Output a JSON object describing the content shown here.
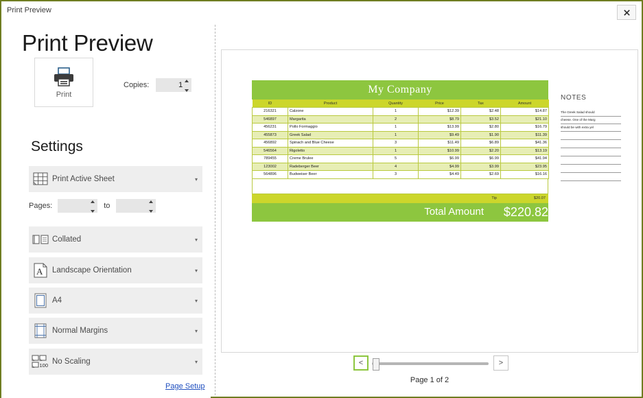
{
  "window": {
    "titlebar_text": "Print Preview",
    "close_icon": "close-icon",
    "border_color": "#6f7d21"
  },
  "left_panel": {
    "page_title": "Print Preview",
    "print_button": {
      "label": "Print",
      "icon": "printer-icon"
    },
    "copies": {
      "label": "Copies:",
      "value": "1"
    },
    "settings_heading": "Settings",
    "options": [
      {
        "label": "Print Active Sheet",
        "icon": "worksheet-grid-icon",
        "caret": "▾"
      },
      {
        "label": "Collated",
        "icon": "collate-pages-icon",
        "caret": "▾"
      },
      {
        "label": "Landscape Orientation",
        "icon": "landscape-page-icon",
        "caret": "▾"
      },
      {
        "label": "A4",
        "icon": "paper-size-icon",
        "caret": "▾"
      },
      {
        "label": "Normal Margins",
        "icon": "margins-icon",
        "caret": "▾"
      },
      {
        "label": "No Scaling",
        "icon": "scaling-100-icon",
        "caret": "▾"
      }
    ],
    "pages": {
      "label": "Pages:",
      "from_value": "",
      "to_label": "to",
      "to_value": ""
    },
    "page_setup_link": "Page Setup"
  },
  "preview": {
    "sheet": {
      "banner_title": "My Company",
      "banner_color": "#8dc63f",
      "header_color": "#ccd62b",
      "alt_row_color": "#e7eeb5",
      "columns": [
        "ID",
        "Product",
        "Quantity",
        "Price",
        "Tax",
        "Amount"
      ],
      "rows": [
        [
          "216321",
          "Calzone",
          "1",
          "$12.39",
          "$2.48",
          "$14.87"
        ],
        [
          "546897",
          "Margarita",
          "2",
          "$8.79",
          "$3.52",
          "$21.10"
        ],
        [
          "456231",
          "Pollo Formaggio",
          "1",
          "$13.99",
          "$2.80",
          "$16.79"
        ],
        [
          "455873",
          "Greek Salad",
          "1",
          "$9.49",
          "$1.90",
          "$11.39"
        ],
        [
          "456892",
          "Spinach and Blue Cheese",
          "3",
          "$11.49",
          "$6.89",
          "$41.36"
        ],
        [
          "546564",
          "Rigoletto",
          "1",
          "$10.99",
          "$2.20",
          "$13.19"
        ],
        [
          "789455",
          "Creme Brulee",
          "5",
          "$6.99",
          "$6.99",
          "$41.94"
        ],
        [
          "123002",
          "Radeberger Beer",
          "4",
          "$4.99",
          "$3.99",
          "$23.95"
        ],
        [
          "564896",
          "Budweiser Beer",
          "3",
          "$4.49",
          "$2.69",
          "$16.16"
        ]
      ],
      "tip_label": "Tip",
      "tip_value": "$20.07",
      "total_label": "Total Amount",
      "total_value": "$220.82"
    },
    "notes": {
      "title": "NOTES",
      "lines": [
        "The Greek Salad should",
        "cheese. One of the Marg",
        "should be with extra yel"
      ],
      "blank_line_count": 6
    }
  },
  "navigation": {
    "prev_label": "<",
    "next_label": ">",
    "page_indicator": "Page 1 of 2"
  }
}
